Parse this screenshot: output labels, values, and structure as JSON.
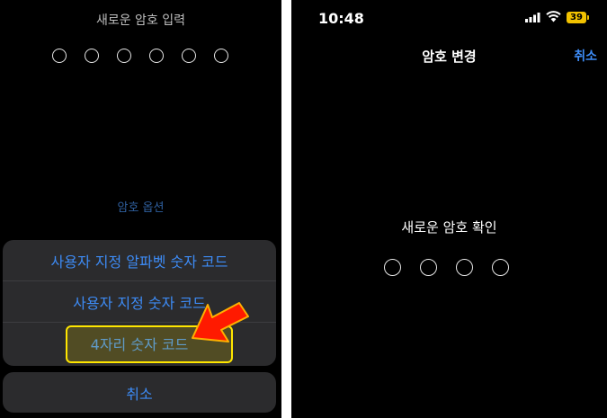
{
  "left": {
    "prompt": "새로운 암호 입력",
    "passcode_dot_count": 6,
    "options_label": "암호 옵션",
    "sheet_items": [
      "사용자 지정 알파벳 숫자 코드",
      "사용자 지정 숫자 코드",
      "4자리 숫자 코드"
    ],
    "cancel_label": "취소"
  },
  "right": {
    "status": {
      "time": "10:48",
      "battery": "39"
    },
    "nav_title": "암호 변경",
    "nav_cancel": "취소",
    "prompt": "새로운 암호 확인",
    "passcode_dot_count": 4
  },
  "colors": {
    "accent_blue": "#3d8bf5",
    "highlight_yellow": "#ffe600",
    "arrow_red": "#ff1a00",
    "battery_yellow": "#f2c200"
  }
}
